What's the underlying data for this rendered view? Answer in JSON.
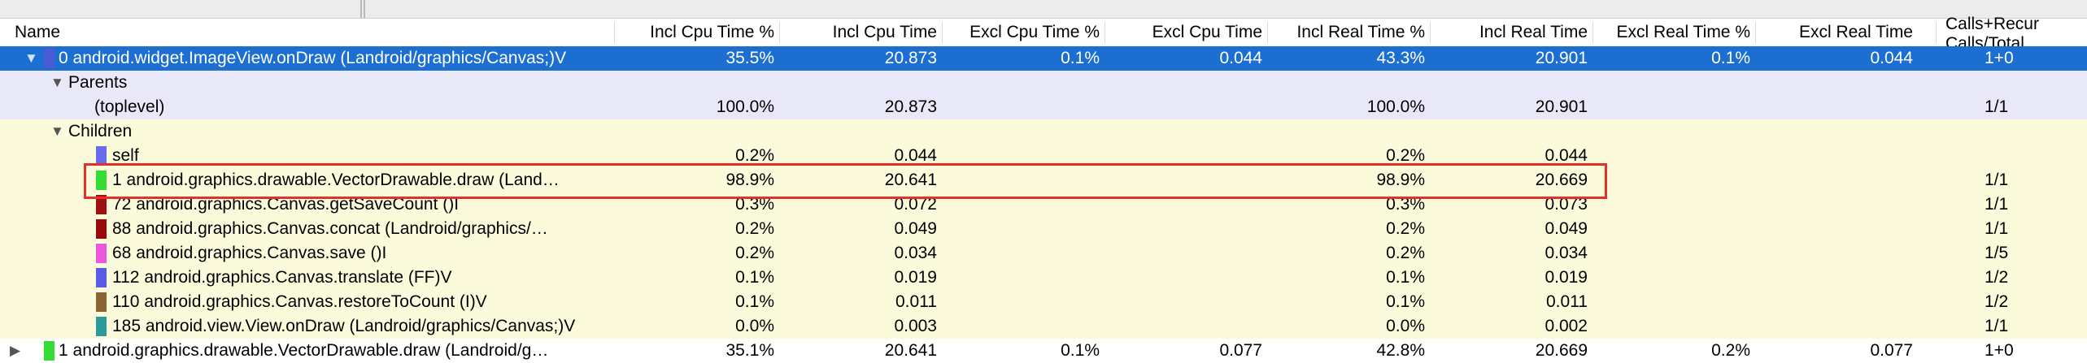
{
  "columns": {
    "name": "Name",
    "incl_cpu_pct": "Incl Cpu Time %",
    "incl_cpu": "Incl Cpu Time",
    "excl_cpu_pct": "Excl Cpu Time %",
    "excl_cpu": "Excl Cpu Time",
    "incl_real_pct": "Incl Real Time %",
    "incl_real": "Incl Real Time",
    "excl_real_pct": "Excl Real Time %",
    "excl_real": "Excl Real Time",
    "calls_line1": "Calls+Recur",
    "calls_line2": "Calls/Total"
  },
  "rows": {
    "main": {
      "name": "0 android.widget.ImageView.onDraw (Landroid/graphics/Canvas;)V",
      "swatch": "#4a5bd6",
      "incl_cpu_pct": "35.5%",
      "incl_cpu": "20.873",
      "excl_cpu_pct": "0.1%",
      "excl_cpu": "0.044",
      "incl_real_pct": "43.3%",
      "incl_real": "20.901",
      "excl_real_pct": "0.1%",
      "excl_real": "0.044",
      "calls": "1+0"
    },
    "parents": {
      "label": "Parents"
    },
    "toplevel": {
      "name": "(toplevel)",
      "incl_cpu_pct": "100.0%",
      "incl_cpu": "20.873",
      "incl_real_pct": "100.0%",
      "incl_real": "20.901",
      "calls": "1/1"
    },
    "children": {
      "label": "Children"
    },
    "child_self": {
      "name": "self",
      "swatch": "#6a6af0",
      "incl_cpu_pct": "0.2%",
      "incl_cpu": "0.044",
      "incl_real_pct": "0.2%",
      "incl_real": "0.044"
    },
    "child_vector": {
      "name": "1 android.graphics.drawable.VectorDrawable.draw (Land…",
      "swatch": "#33dd33",
      "incl_cpu_pct": "98.9%",
      "incl_cpu": "20.641",
      "incl_real_pct": "98.9%",
      "incl_real": "20.669",
      "calls": "1/1"
    },
    "child_getsave": {
      "name": "72 android.graphics.Canvas.getSaveCount ()I",
      "swatch": "#a01010",
      "incl_cpu_pct": "0.3%",
      "incl_cpu": "0.072",
      "incl_real_pct": "0.3%",
      "incl_real": "0.073",
      "calls": "1/1"
    },
    "child_concat": {
      "name": "88 android.graphics.Canvas.concat (Landroid/graphics/…",
      "swatch": "#9a0a0a",
      "incl_cpu_pct": "0.2%",
      "incl_cpu": "0.049",
      "incl_real_pct": "0.2%",
      "incl_real": "0.049",
      "calls": "1/1"
    },
    "child_save": {
      "name": "68 android.graphics.Canvas.save ()I",
      "swatch": "#ee55dd",
      "incl_cpu_pct": "0.2%",
      "incl_cpu": "0.034",
      "incl_real_pct": "0.2%",
      "incl_real": "0.034",
      "calls": "1/5"
    },
    "child_translate": {
      "name": "112 android.graphics.Canvas.translate (FF)V",
      "swatch": "#5b5be8",
      "incl_cpu_pct": "0.1%",
      "incl_cpu": "0.019",
      "incl_real_pct": "0.1%",
      "incl_real": "0.019",
      "calls": "1/2"
    },
    "child_restore": {
      "name": "110 android.graphics.Canvas.restoreToCount (I)V",
      "swatch": "#8a6433",
      "incl_cpu_pct": "0.1%",
      "incl_cpu": "0.011",
      "incl_real_pct": "0.1%",
      "incl_real": "0.011",
      "calls": "1/2"
    },
    "child_viewondraw": {
      "name": "185 android.view.View.onDraw (Landroid/graphics/Canvas;)V",
      "swatch": "#2a9a9a",
      "incl_cpu_pct": "0.0%",
      "incl_cpu": "0.003",
      "incl_real_pct": "0.0%",
      "incl_real": "0.002",
      "calls": "1/1"
    },
    "next": {
      "name": "1 android.graphics.drawable.VectorDrawable.draw (Landroid/g…",
      "swatch": "#33dd33",
      "incl_cpu_pct": "35.1%",
      "incl_cpu": "20.641",
      "excl_cpu_pct": "0.1%",
      "excl_cpu": "0.077",
      "incl_real_pct": "42.8%",
      "incl_real": "20.669",
      "excl_real_pct": "0.2%",
      "excl_real": "0.077",
      "calls": "1+0"
    }
  }
}
